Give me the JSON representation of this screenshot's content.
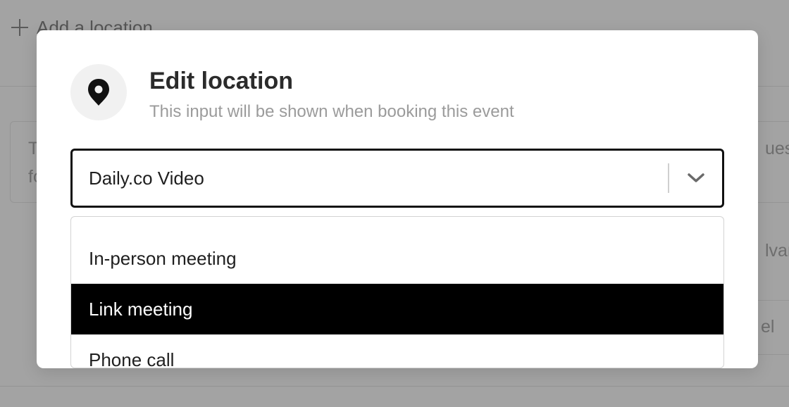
{
  "background": {
    "add_location_label": "Add a location",
    "card_text_fragment_1": "T",
    "card_text_fragment_2": "fo",
    "right_fragment_1": "ues",
    "right_fragment_2": "lvan",
    "right_fragment_3": "el"
  },
  "modal": {
    "icon": "map-pin-icon",
    "title": "Edit location",
    "subtitle": "This input will be shown when booking this event",
    "select": {
      "value": "Daily.co Video",
      "chevron_icon": "chevron-down-icon"
    },
    "options": [
      {
        "label": "In-person meeting",
        "selected": false
      },
      {
        "label": "Link meeting",
        "selected": true
      },
      {
        "label": "Phone call",
        "selected": false
      }
    ]
  },
  "colors": {
    "overlay": "#a3a3a3",
    "modal_bg": "#ffffff",
    "selected_bg": "#000000",
    "selected_text": "#ffffff",
    "muted_text": "#9b9b9b"
  }
}
